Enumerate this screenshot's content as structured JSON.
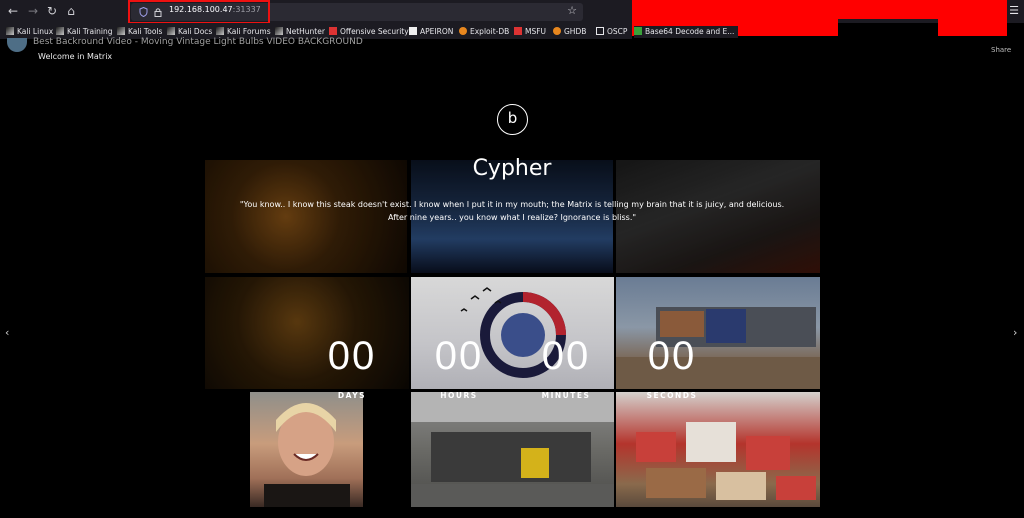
{
  "browser": {
    "url_host": "192.168.100.47",
    "url_port": ":31337",
    "bookmarks": [
      "Kali Linux",
      "Kali Training",
      "Kali Tools",
      "Kali Docs",
      "Kali Forums",
      "NetHunter",
      "Offensive Security",
      "APEIRON",
      "Exploit-DB",
      "MSFU",
      "GHDB",
      "OSCP",
      "Base64 Decode and E..."
    ]
  },
  "video": {
    "title": "Best Backround Video - Moving Vintage Light Bulbs VIDEO BACKGROUND",
    "share": "Share"
  },
  "page": {
    "welcome": "Welcome in Matrix",
    "logo_letter": "b",
    "heading": "Cypher",
    "quote_line1": "\"You know.. I know this steak doesn't exist. I know when I put it in my mouth; the Matrix is telling my brain that it is juicy, and delicious.",
    "quote_line2": "After nine years.. you know what I realize? Ignorance is bliss.\""
  },
  "countdown": [
    {
      "value": "00",
      "label": "DAYS"
    },
    {
      "value": "00",
      "label": "HOURS"
    },
    {
      "value": "00",
      "label": "MINUTES"
    },
    {
      "value": "00",
      "label": "SECONDS"
    }
  ],
  "icons": {
    "back": "arrow-left-icon",
    "forward": "arrow-right-icon",
    "reload": "reload-icon",
    "home": "home-icon",
    "shield": "shield-icon",
    "lock": "lock-icon",
    "star": "star-icon",
    "menu": "hamburger-menu-icon",
    "prev": "chevron-left-icon",
    "next": "chevron-right-icon"
  }
}
